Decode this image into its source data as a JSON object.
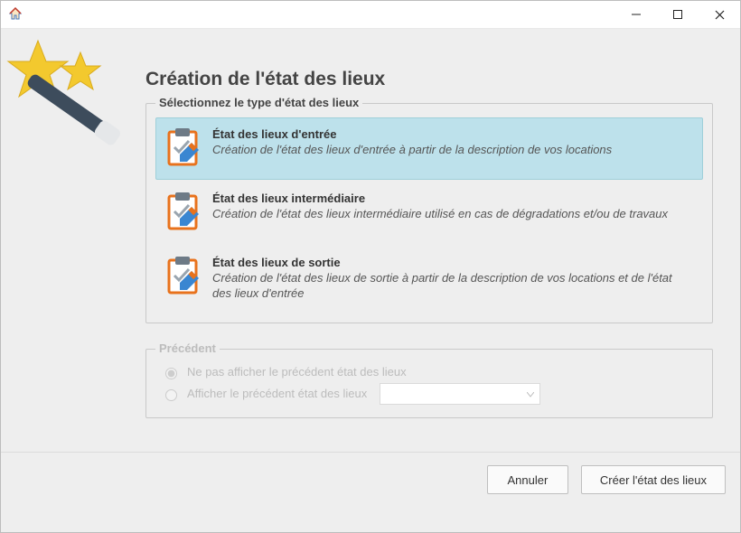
{
  "window": {
    "app_icon": "house-icon"
  },
  "page_title": "Création de l'état des lieux",
  "type_section": {
    "legend": "Sélectionnez le type d'état des lieux",
    "options": [
      {
        "id": "entry",
        "title": "État des lieux d'entrée",
        "desc": "Création de l'état des lieux d'entrée à partir de la description de vos locations",
        "selected": true
      },
      {
        "id": "intermediate",
        "title": "État des lieux intermédiaire",
        "desc": "Création de l'état des lieux intermédiaire utilisé en cas de dégradations et/ou de travaux",
        "selected": false
      },
      {
        "id": "exit",
        "title": "État des lieux de sortie",
        "desc": "Création de l'état des lieux de sortie à partir de la description de vos locations et de l'état des lieux d'entrée",
        "selected": false
      }
    ]
  },
  "previous_section": {
    "legend": "Précédent",
    "enabled": false,
    "radios": [
      {
        "id": "hide",
        "label": "Ne pas afficher le précédent état des lieux",
        "checked": true
      },
      {
        "id": "show",
        "label": "Afficher le précédent état des lieux",
        "checked": false
      }
    ],
    "combo_value": ""
  },
  "buttons": {
    "cancel": "Annuler",
    "create": "Créer l'état des lieux"
  }
}
